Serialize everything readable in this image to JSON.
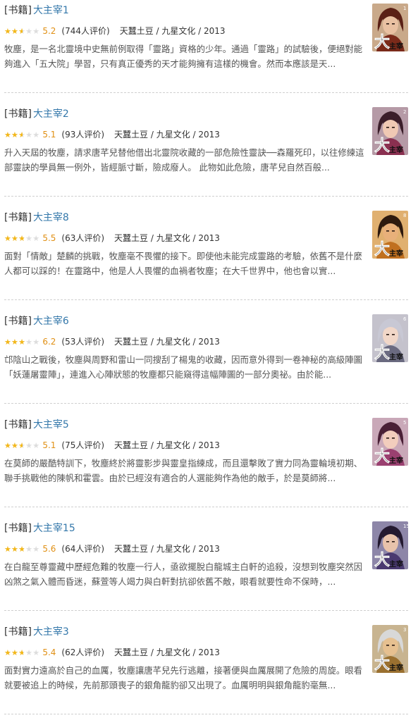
{
  "books": [
    {
      "category": "[书籍]",
      "title": "大主宰1",
      "rating": 5.2,
      "score": "5.2",
      "count": "(744人评价)",
      "publisher": "天蠶土豆 / 九星文化 / 2013",
      "volume": "1",
      "desc": "牧塵，是一名北靈境中史無前例取得「靈路」資格的少年。通過「靈路」的試驗後，便絕對能夠進入「五大院」學習，只有真正優秀的天才能夠擁有這樣的機會。然而本應該是天...",
      "hair": "#5a2016",
      "skin": "#e9c1a2",
      "bg": "#c9a98a",
      "accent": "#7a2a1a"
    },
    {
      "category": "[书籍]",
      "title": "大主宰2",
      "rating": 5.1,
      "score": "5.1",
      "count": "(93人评价)",
      "publisher": "天蠶土豆 / 九星文化 / 2013",
      "volume": "2",
      "desc": "升入天屆的牧塵，請求唐芊兒替他借出北靈院收藏的一部危險性靈訣──森羅死印，以往修練這部靈訣的學員無一例外，皆經脈寸斷，險成廢人。 此物如此危險，唐芊兒自然百般...",
      "hair": "#3b1e2a",
      "skin": "#f0c9b4",
      "bg": "#b59aa6",
      "accent": "#8a3050"
    },
    {
      "category": "[书籍]",
      "title": "大主宰8",
      "rating": 5.5,
      "score": "5.5",
      "count": "(63人评价)",
      "publisher": "天蠶土豆 / 九星文化 / 2013",
      "volume": "8",
      "desc": "面對「情敵」楚麟的挑戰，牧塵毫不畏懼的接下。即使他未能完成靈路的考驗，依舊不是什麼人都可以踩的！在靈路中，他是人人畏懼的血禍者牧塵；在大千世界中，他也會以實...",
      "hair": "#2e1a0e",
      "skin": "#e8b07a",
      "bg": "#e0b070",
      "accent": "#c07020"
    },
    {
      "category": "[书籍]",
      "title": "大主宰6",
      "rating": 6.2,
      "score": "6.2",
      "count": "(53人评价)",
      "publisher": "天蠶土豆 / 九星文化 / 2013",
      "volume": "6",
      "desc": "邙陰山之戰後，牧塵與周野和雷山一同搜刮了楊鬼的收藏，因而意外得到一卷神秘的高級陣圖「妖蓮屠靈陣」，連進入心陣狀態的牧塵都只能窺得這幅陣圖的一部分奧祕。由於能...",
      "hair": "#c8c8d4",
      "skin": "#f1d7c8",
      "bg": "#c4c2cc",
      "accent": "#6a6a80"
    },
    {
      "category": "[书籍]",
      "title": "大主宰5",
      "rating": 5.1,
      "score": "5.1",
      "count": "(75人评价)",
      "publisher": "天蠶土豆 / 九星文化 / 2013",
      "volume": "5",
      "desc": "在莫師的嚴酷特訓下，牧塵終於將靈影步與靈皇指練成，而且還擊敗了實力同為靈輪境初期、聯手挑戰他的陳帆和霍雲。由於已經沒有適合的人選能夠作為他的敵手，於是莫師將...",
      "hair": "#4a2036",
      "skin": "#f2cdbd",
      "bg": "#c9a8b8",
      "accent": "#9a4070"
    },
    {
      "category": "[书籍]",
      "title": "大主宰15",
      "rating": 5.6,
      "score": "5.6",
      "count": "(64人评价)",
      "publisher": "天蠶土豆 / 九星文化 / 2013",
      "volume": "15",
      "desc": "在白龍至尊靈藏中歷經危難的牧塵一行人，亟欲擺脫白龍城主白軒的追殺，沒想到牧塵突然因凶煞之氣入體而昏迷，蘇萱等人竭力與白軒對抗卻依舊不敵，眼看就要性命不保時，...",
      "hair": "#241a30",
      "skin": "#e8c3ab",
      "bg": "#8d86a8",
      "accent": "#4a3a70"
    },
    {
      "category": "[书籍]",
      "title": "大主宰3",
      "rating": 5.4,
      "score": "5.4",
      "count": "(62人评价)",
      "publisher": "天蠶土豆 / 九星文化 / 2013",
      "volume": "3",
      "desc": "面對實力遠高於自己的血厲，牧塵讓唐芊兒先行逃離，接著便與血厲展開了危險的周旋。眼看就要被追上的時候，先前那頭喪子的銀角龍豹卻又出現了。血厲明明與銀角龍豹毫無...",
      "hair": "#d8d8d8",
      "skin": "#e6c090",
      "bg": "#c8b490",
      "accent": "#9a7030"
    }
  ]
}
